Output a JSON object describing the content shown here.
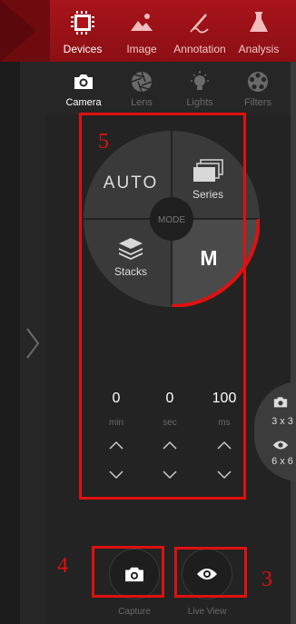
{
  "topnav": {
    "tabs": [
      {
        "label": "Devices",
        "icon": "devices-icon",
        "active": true
      },
      {
        "label": "Image",
        "icon": "image-icon",
        "active": false
      },
      {
        "label": "Annotation",
        "icon": "annotation-icon",
        "active": false
      },
      {
        "label": "Analysis",
        "icon": "analysis-icon",
        "active": false
      }
    ]
  },
  "subnav": {
    "items": [
      {
        "label": "Camera",
        "icon": "camera-icon",
        "active": true
      },
      {
        "label": "Lens",
        "icon": "lens-icon",
        "active": false
      },
      {
        "label": "Lights",
        "icon": "lights-icon",
        "active": false
      },
      {
        "label": "Filters",
        "icon": "filters-icon",
        "active": false
      }
    ]
  },
  "mode_dial": {
    "auto": "AUTO",
    "series": "Series",
    "stacks": "Stacks",
    "manual": "M",
    "center": "MODE",
    "selected": "M"
  },
  "timer": {
    "min": {
      "value": "0",
      "unit": "min"
    },
    "sec": {
      "value": "0",
      "unit": "sec"
    },
    "ms": {
      "value": "100",
      "unit": "ms"
    }
  },
  "side_popup": {
    "grid1": "3 x 3",
    "grid2": "6 x 6"
  },
  "actions": {
    "capture": "Capture",
    "live_view": "Live View"
  },
  "annotations": {
    "n5": "5",
    "n4": "4",
    "n3": "3"
  },
  "colors": {
    "accent_red": "#e01010",
    "nav_red": "#8d0f14",
    "background": "#1f1f1f"
  }
}
